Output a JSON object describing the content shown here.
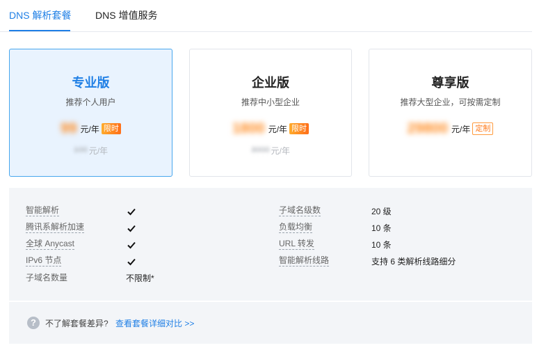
{
  "tabs": [
    {
      "label": "DNS 解析套餐",
      "active": true
    },
    {
      "label": "DNS 增值服务",
      "active": false
    }
  ],
  "plans": [
    {
      "name": "专业版",
      "subtitle": "推荐个人用户",
      "price": "99",
      "unit": "元/年",
      "badge": "限时",
      "original_price": "100",
      "original_unit": "元/年",
      "selected": true
    },
    {
      "name": "企业版",
      "subtitle": "推荐中小型企业",
      "price": "1800",
      "unit": "元/年",
      "badge": "限时",
      "original_price": "3000",
      "original_unit": "元/年",
      "selected": false
    },
    {
      "name": "尊享版",
      "subtitle": "推荐大型企业，可按需定制",
      "price": "29800",
      "unit": "元/年",
      "badge": "定制",
      "selected": false
    }
  ],
  "features_left": [
    {
      "label": "智能解析",
      "value": "check-icon"
    },
    {
      "label": "腾讯系解析加速",
      "value": "check-icon"
    },
    {
      "label": "全球 Anycast",
      "value": "check-icon"
    },
    {
      "label": "IPv6 节点",
      "value": "check-icon"
    },
    {
      "label": "子域名数量",
      "value": "不限制*"
    }
  ],
  "features_right": [
    {
      "label": "子域名级数",
      "value": "20 级"
    },
    {
      "label": "负载均衡",
      "value": "10 条"
    },
    {
      "label": "URL 转发",
      "value": "10 条"
    },
    {
      "label": "智能解析线路",
      "value": "支持 6 类解析线路细分"
    }
  ],
  "footer": {
    "question": "不了解套餐差异?",
    "link": "查看套餐详细对比 >>"
  },
  "colors": {
    "accent": "#1f7fe5",
    "price": "#ff8a1f",
    "selected_bg": "#e9f3fe"
  }
}
